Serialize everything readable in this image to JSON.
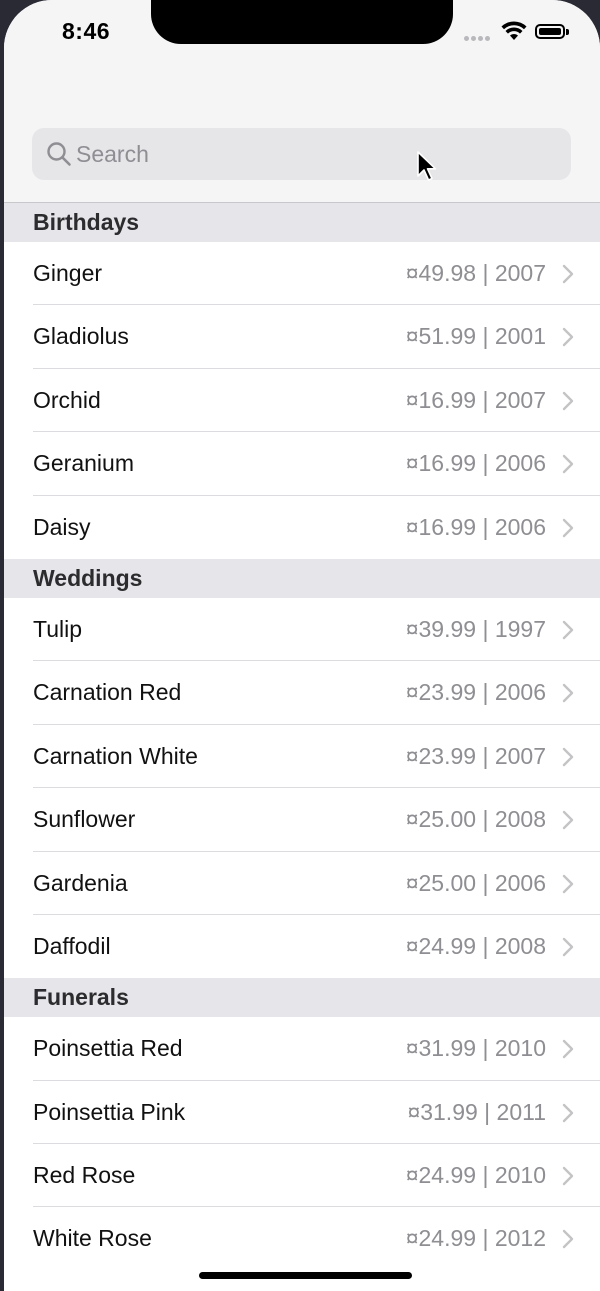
{
  "status_bar": {
    "time": "8:46"
  },
  "search": {
    "placeholder": "Search",
    "value": ""
  },
  "sections": [
    {
      "title": "Birthdays",
      "rows": [
        {
          "name": "Ginger",
          "detail": "¤49.98 | 2007"
        },
        {
          "name": "Gladiolus",
          "detail": "¤51.99 | 2001"
        },
        {
          "name": "Orchid",
          "detail": "¤16.99 | 2007"
        },
        {
          "name": "Geranium",
          "detail": "¤16.99 | 2006"
        },
        {
          "name": "Daisy",
          "detail": "¤16.99 | 2006"
        }
      ]
    },
    {
      "title": "Weddings",
      "rows": [
        {
          "name": "Tulip",
          "detail": "¤39.99 | 1997"
        },
        {
          "name": "Carnation Red",
          "detail": "¤23.99 | 2006"
        },
        {
          "name": "Carnation White",
          "detail": "¤23.99 | 2007"
        },
        {
          "name": "Sunflower",
          "detail": "¤25.00 | 2008"
        },
        {
          "name": "Gardenia",
          "detail": "¤25.00 | 2006"
        },
        {
          "name": "Daffodil",
          "detail": "¤24.99 | 2008"
        }
      ]
    },
    {
      "title": "Funerals",
      "rows": [
        {
          "name": "Poinsettia Red",
          "detail": "¤31.99 | 2010"
        },
        {
          "name": "Poinsettia Pink",
          "detail": "¤31.99 | 2011"
        },
        {
          "name": "Red Rose",
          "detail": "¤24.99 | 2010"
        },
        {
          "name": "White Rose",
          "detail": "¤24.99 | 2012"
        }
      ]
    }
  ],
  "icons": {
    "search": "search-icon",
    "chevron": "chevron-right-icon",
    "wifi": "wifi-icon",
    "battery": "battery-icon",
    "signal": "signal-icon",
    "cursor": "mouse-pointer-icon"
  },
  "colors": {
    "section_header_bg": "#e5e5ea",
    "secondary_text": "#8e8e93",
    "search_bg": "#e6e6e9"
  }
}
